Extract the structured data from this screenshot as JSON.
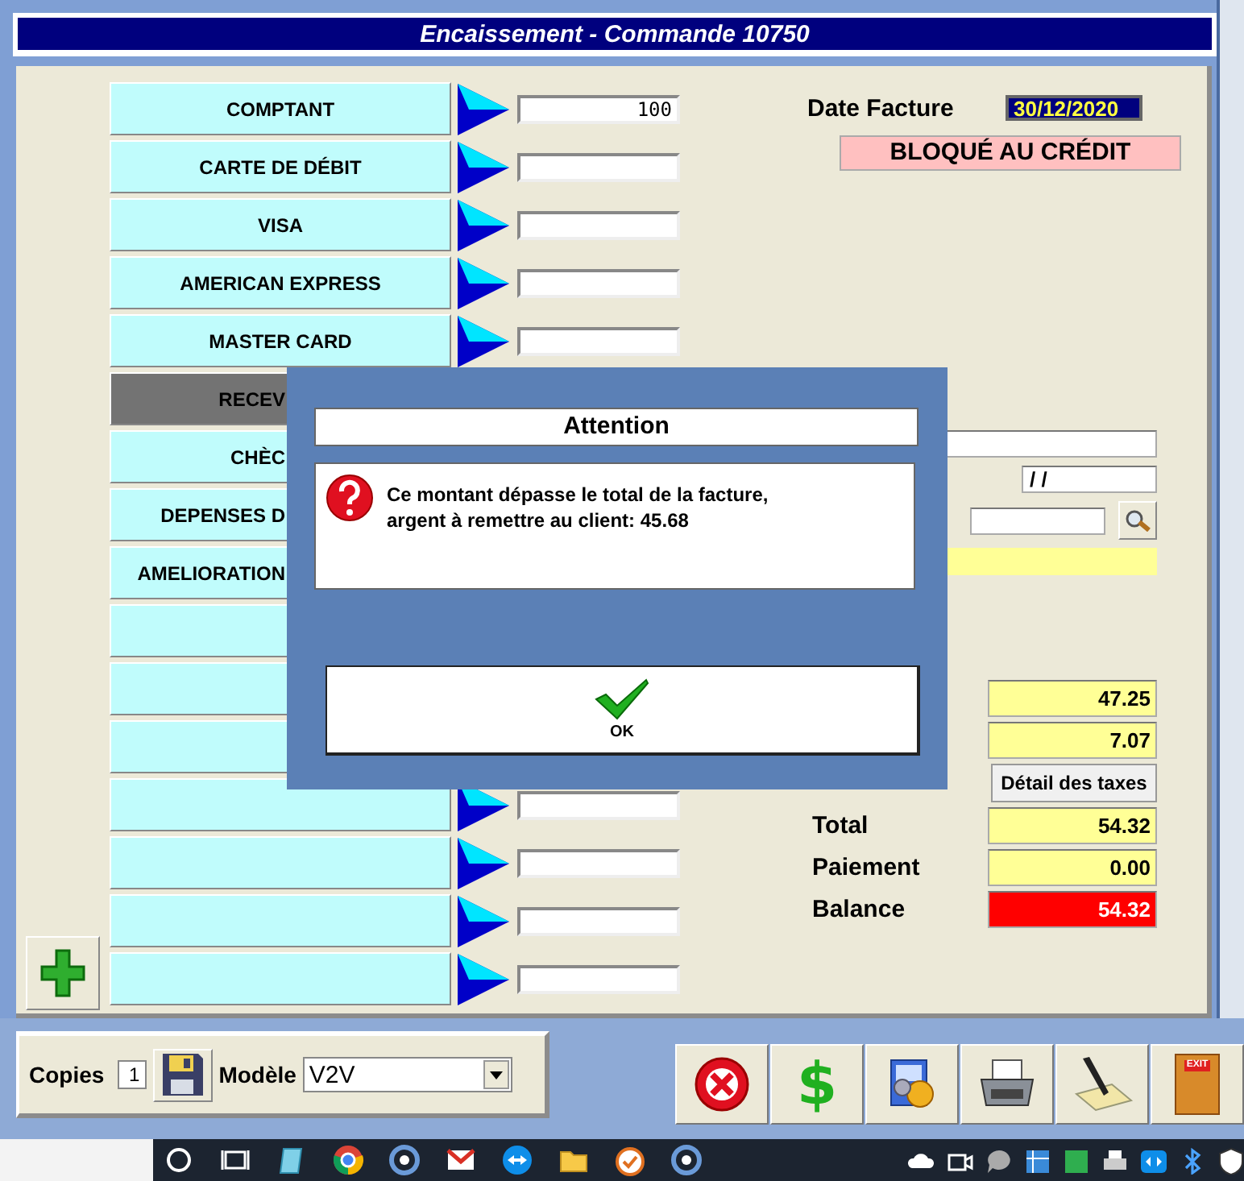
{
  "window": {
    "title": "Encaissement - Commande 10750"
  },
  "payment_methods": [
    {
      "label": "COMPTANT",
      "amount": "100",
      "disabled": false
    },
    {
      "label": "CARTE DE DÉBIT",
      "disabled": false
    },
    {
      "label": "VISA",
      "disabled": false
    },
    {
      "label": "AMERICAN EXPRESS",
      "disabled": false
    },
    {
      "label": "MASTER CARD",
      "disabled": false
    },
    {
      "label": "RECEV",
      "disabled": true
    },
    {
      "label": "CHÈC",
      "disabled": false
    },
    {
      "label": "DEPENSES D",
      "disabled": false
    },
    {
      "label": "AMELIORATION",
      "disabled": false
    },
    {
      "disabled": false
    },
    {
      "disabled": false
    },
    {
      "disabled": false
    },
    {
      "disabled": false
    },
    {
      "disabled": false
    },
    {
      "disabled": false
    },
    {
      "disabled": false
    }
  ],
  "invoice": {
    "date_label": "Date Facture",
    "date": "30/12/2020",
    "status": "BLOQUÉ AU CRÉDIT"
  },
  "customer_fields": [
    {
      "kind": "text"
    },
    {
      "kind": "date",
      "value": "/ /"
    },
    {
      "kind": "lookup"
    },
    {
      "kind": "highlight"
    }
  ],
  "amounts": [
    {
      "value": "47.25"
    },
    {
      "value": "7.07"
    }
  ],
  "tax_detail_button": "Détail des taxes",
  "totals": [
    {
      "label": "Total",
      "value": "54.32",
      "kind": "normal"
    },
    {
      "label": "Paiement",
      "value": "0.00",
      "kind": "normal"
    },
    {
      "label": "Balance",
      "value": "54.32",
      "kind": "alert"
    }
  ],
  "print": {
    "copies_label": "Copies",
    "copies": "1",
    "model_label": "Modèle",
    "model": "V2V"
  },
  "toolbar": [
    {
      "kind": "cancel"
    },
    {
      "kind": "payment",
      "label": "$"
    },
    {
      "kind": "settings"
    },
    {
      "kind": "print"
    },
    {
      "kind": "sign"
    },
    {
      "kind": "exit",
      "label": "EXIT"
    }
  ],
  "dialog": {
    "title": "Attention",
    "message": "Ce montant dépasse le total de la facture,\nargent à remettre au client: 45.68",
    "button": "OK"
  }
}
